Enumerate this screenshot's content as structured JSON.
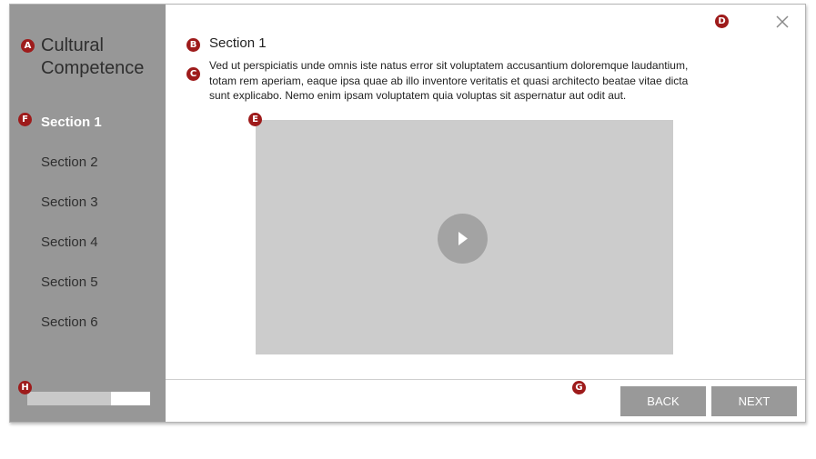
{
  "sidebar": {
    "course_title": "Cultural Competence",
    "items": [
      {
        "label": "Section 1",
        "active": true
      },
      {
        "label": "Section 2"
      },
      {
        "label": "Section 3"
      },
      {
        "label": "Section 4"
      },
      {
        "label": "Section 5"
      },
      {
        "label": "Section 6"
      }
    ],
    "progress": 0.68
  },
  "main": {
    "heading": "Section 1",
    "body": "Ved ut perspiciatis unde omnis iste natus error sit voluptatem accusantium doloremque laudantium, totam rem aperiam, eaque ipsa quae ab illo inventore veritatis et quasi architecto beatae vitae dicta sunt explicabo. Nemo enim ipsam voluptatem quia voluptas sit aspernatur aut odit aut.",
    "video": {
      "play_icon": "play-icon"
    }
  },
  "footer": {
    "back_label": "BACK",
    "next_label": "NEXT"
  },
  "close_icon": "close-icon",
  "markers": {
    "a": "A",
    "b": "B",
    "c": "C",
    "d": "D",
    "e": "E",
    "f": "F",
    "g": "G",
    "h": "H"
  },
  "colors": {
    "sidebar": "#979797",
    "marker": "#9e1b1b",
    "button": "#999999",
    "video": "#cccccc"
  }
}
